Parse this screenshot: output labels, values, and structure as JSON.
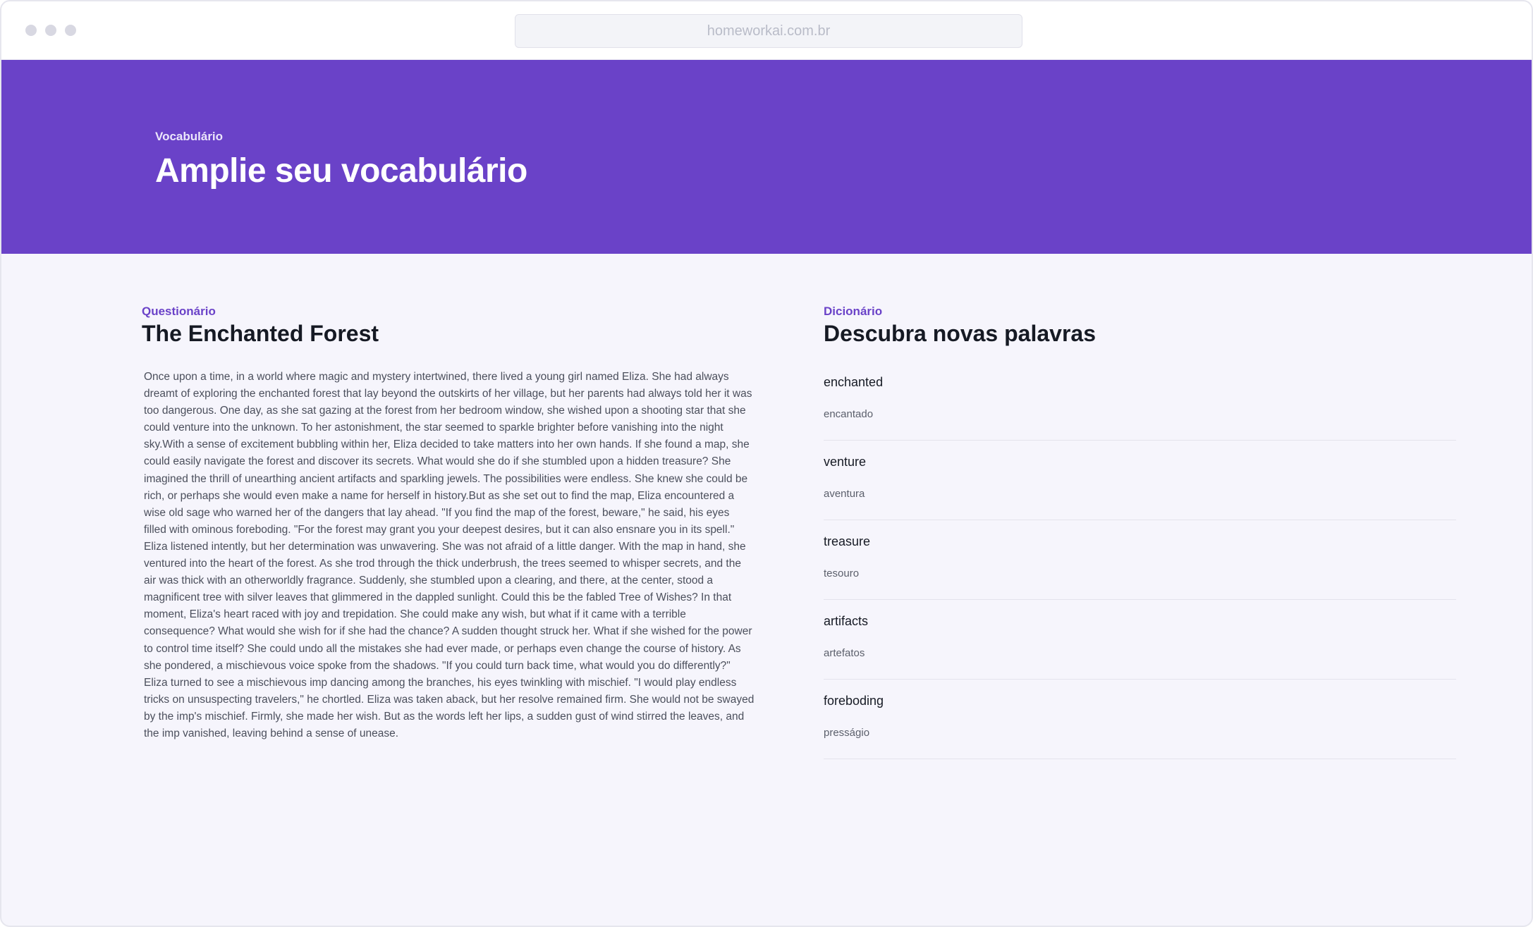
{
  "browser": {
    "url": "homeworkai.com.br"
  },
  "hero": {
    "label": "Vocabulário",
    "title": "Amplie seu vocabulário"
  },
  "quiz": {
    "kicker": "Questionário",
    "title": "The Enchanted Forest",
    "story": "Once upon a time, in a world where magic and mystery intertwined, there lived a young girl named Eliza. She had always dreamt of exploring the enchanted forest that lay beyond the outskirts of her village, but her parents had always told her it was too dangerous. One day, as she sat gazing at the forest from her bedroom window, she wished upon a shooting star that she could venture into the unknown. To her astonishment, the star seemed to sparkle brighter before vanishing into the night sky.With a sense of excitement bubbling within her, Eliza decided to take matters into her own hands. If she found a map, she could easily navigate the forest and discover its secrets. What would she do if she stumbled upon a hidden treasure? She imagined the thrill of unearthing ancient artifacts and sparkling jewels. The possibilities were endless. She knew she could be rich, or perhaps she would even make a name for herself in history.But as she set out to find the map, Eliza encountered a wise old sage who warned her of the dangers that lay ahead. \"If you find the map of the forest, beware,\" he said, his eyes filled with ominous foreboding. \"For the forest may grant you your deepest desires, but it can also ensnare you in its spell.\" Eliza listened intently, but her determination was unwavering. She was not afraid of a little danger. With the map in hand, she ventured into the heart of the forest. As she trod through the thick underbrush, the trees seemed to whisper secrets, and the air was thick with an otherworldly fragrance. Suddenly, she stumbled upon a clearing, and there, at the center, stood a magnificent tree with silver leaves that glimmered in the dappled sunlight. Could this be the fabled Tree of Wishes? In that moment, Eliza's heart raced with joy and trepidation. She could make any wish, but what if it came with a terrible consequence? What would she wish for if she had the chance? A sudden thought struck her. What if she wished for the power to control time itself? She could undo all the mistakes she had ever made, or perhaps even change the course of history. As she pondered, a mischievous voice spoke from the shadows. \"If you could turn back time, what would you do differently?\" Eliza turned to see a mischievous imp dancing among the branches, his eyes twinkling with mischief. \"I would play endless tricks on unsuspecting travelers,\" he chortled. Eliza was taken aback, but her resolve remained firm. She would not be swayed by the imp's mischief. Firmly, she made her wish. But as the words left her lips, a sudden gust of wind stirred the leaves, and the imp vanished, leaving behind a sense of unease."
  },
  "dictionary": {
    "kicker": "Dicionário",
    "title": "Descubra novas palavras",
    "entries": [
      {
        "word": "enchanted",
        "translation": "encantado"
      },
      {
        "word": "venture",
        "translation": "aventura"
      },
      {
        "word": "treasure",
        "translation": "tesouro"
      },
      {
        "word": "artifacts",
        "translation": "artefatos"
      },
      {
        "word": "foreboding",
        "translation": "presságio"
      }
    ]
  },
  "colors": {
    "brand": "#6a42c8",
    "page_bg": "#f6f5fc"
  }
}
